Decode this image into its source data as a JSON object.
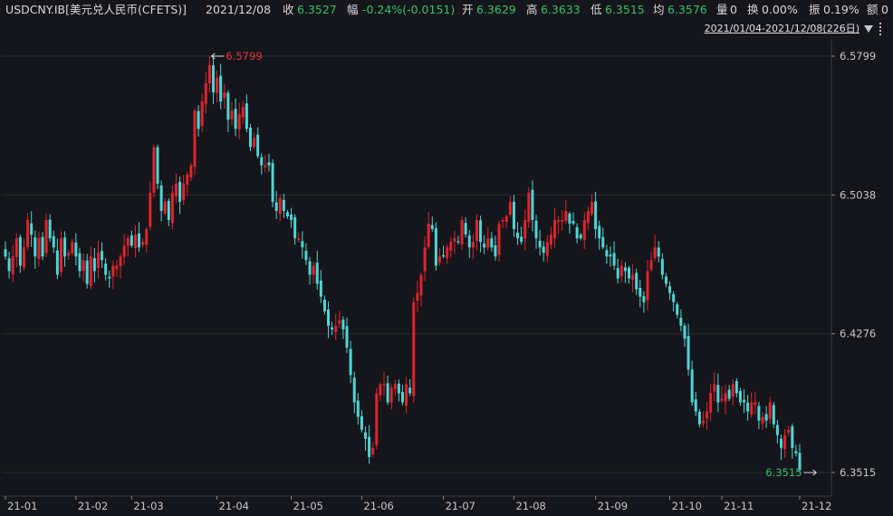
{
  "header": {
    "symbol": "USDCNY.IB[美元兑人民币(CFETS)]",
    "date": "2021/12/08",
    "close_label": "收",
    "close_value": "6.3527",
    "change_label": "幅",
    "change_value": "-0.24%(-0.0151)",
    "open_label": "开",
    "open_value": "6.3629",
    "high_label": "高",
    "high_value": "6.3633",
    "low_label": "低",
    "low_value": "6.3515",
    "avg_label": "均",
    "avg_value": "6.3576",
    "volume_label": "量",
    "volume_value": "0",
    "turnover_label": "换",
    "turnover_value": "0.00%",
    "amplitude_label": "振",
    "amplitude_value": "0.19%",
    "amount_label": "额",
    "amount_value": "0"
  },
  "range_selector": {
    "label": "2021/01/04-2021/12/08(226日)"
  },
  "colors": {
    "up": "#e0242c",
    "down": "#4ed6d6",
    "background": "#15161b",
    "grid": "#2a2c33",
    "axis_text": "#c8c8c8",
    "max_label": "#e6343b",
    "min_label": "#35c06a"
  },
  "chart_data": {
    "type": "candlestick",
    "yticks": [
      "6.5799",
      "6.5038",
      "6.4276",
      "6.3515"
    ],
    "ylim": [
      6.3515,
      6.5799
    ],
    "xticks": [
      {
        "label": "21-01",
        "index": 0
      },
      {
        "label": "21-02",
        "index": 19
      },
      {
        "label": "21-03",
        "index": 34
      },
      {
        "label": "21-04",
        "index": 57
      },
      {
        "label": "21-05",
        "index": 77
      },
      {
        "label": "21-06",
        "index": 96
      },
      {
        "label": "21-07",
        "index": 118
      },
      {
        "label": "21-08",
        "index": 137
      },
      {
        "label": "21-09",
        "index": 159
      },
      {
        "label": "21-10",
        "index": 179
      },
      {
        "label": "21-11",
        "index": 193
      },
      {
        "label": "21-12",
        "index": 214
      }
    ],
    "max_marker": {
      "value": "6.5799",
      "index": 55
    },
    "min_marker": {
      "value": "6.3515",
      "index": 219
    },
    "closes": [
      6.47,
      6.462,
      6.47,
      6.48,
      6.465,
      6.475,
      6.49,
      6.482,
      6.47,
      6.48,
      6.47,
      6.49,
      6.48,
      6.475,
      6.46,
      6.48,
      6.47,
      6.472,
      6.478,
      6.47,
      6.462,
      6.468,
      6.455,
      6.47,
      6.462,
      6.472,
      6.468,
      6.46,
      6.458,
      6.465,
      6.465,
      6.47,
      6.476,
      6.48,
      6.476,
      6.482,
      6.475,
      6.478,
      6.485,
      6.505,
      6.53,
      6.51,
      6.495,
      6.5,
      6.49,
      6.505,
      6.51,
      6.5,
      6.51,
      6.515,
      6.52,
      6.55,
      6.54,
      6.555,
      6.565,
      6.575,
      6.56,
      6.568,
      6.555,
      6.56,
      6.545,
      6.55,
      6.54,
      6.548,
      6.552,
      6.54,
      6.53,
      6.535,
      6.525,
      6.52,
      6.52,
      6.52,
      6.5,
      6.495,
      6.502,
      6.495,
      6.492,
      6.49,
      6.48,
      6.48,
      6.475,
      6.468,
      6.46,
      6.465,
      6.455,
      6.448,
      6.44,
      6.432,
      6.43,
      6.432,
      6.435,
      6.43,
      6.42,
      6.405,
      6.39,
      6.382,
      6.375,
      6.37,
      6.36,
      6.365,
      6.395,
      6.4,
      6.4,
      6.39,
      6.398,
      6.4,
      6.395,
      6.39,
      6.4,
      6.395,
      6.445,
      6.45,
      6.46,
      6.475,
      6.488,
      6.485,
      6.465,
      6.47,
      6.47,
      6.475,
      6.478,
      6.48,
      6.478,
      6.49,
      6.482,
      6.475,
      6.478,
      6.49,
      6.478,
      6.475,
      6.48,
      6.475,
      6.47,
      6.488,
      6.49,
      6.492,
      6.5,
      6.485,
      6.48,
      6.478,
      6.49,
      6.505,
      6.49,
      6.48,
      6.475,
      6.472,
      6.478,
      6.482,
      6.49,
      6.49,
      6.49,
      6.495,
      6.488,
      6.488,
      6.48,
      6.48,
      6.49,
      6.495,
      6.5,
      6.485,
      6.48,
      6.475,
      6.47,
      6.47,
      6.465,
      6.458,
      6.465,
      6.462,
      6.458,
      6.46,
      6.452,
      6.448,
      6.445,
      6.462,
      6.468,
      6.475,
      6.47,
      6.46,
      6.455,
      6.45,
      6.445,
      6.438,
      6.432,
      6.425,
      6.408,
      6.39,
      6.385,
      6.378,
      6.38,
      6.385,
      6.395,
      6.4,
      6.39,
      6.392,
      6.395,
      6.392,
      6.4,
      6.395,
      6.39,
      6.39,
      6.385,
      6.39,
      6.39,
      6.38,
      6.382,
      6.38,
      6.39,
      6.378,
      6.372,
      6.365,
      6.372,
      6.375,
      6.365,
      6.362,
      6.3527
    ]
  }
}
